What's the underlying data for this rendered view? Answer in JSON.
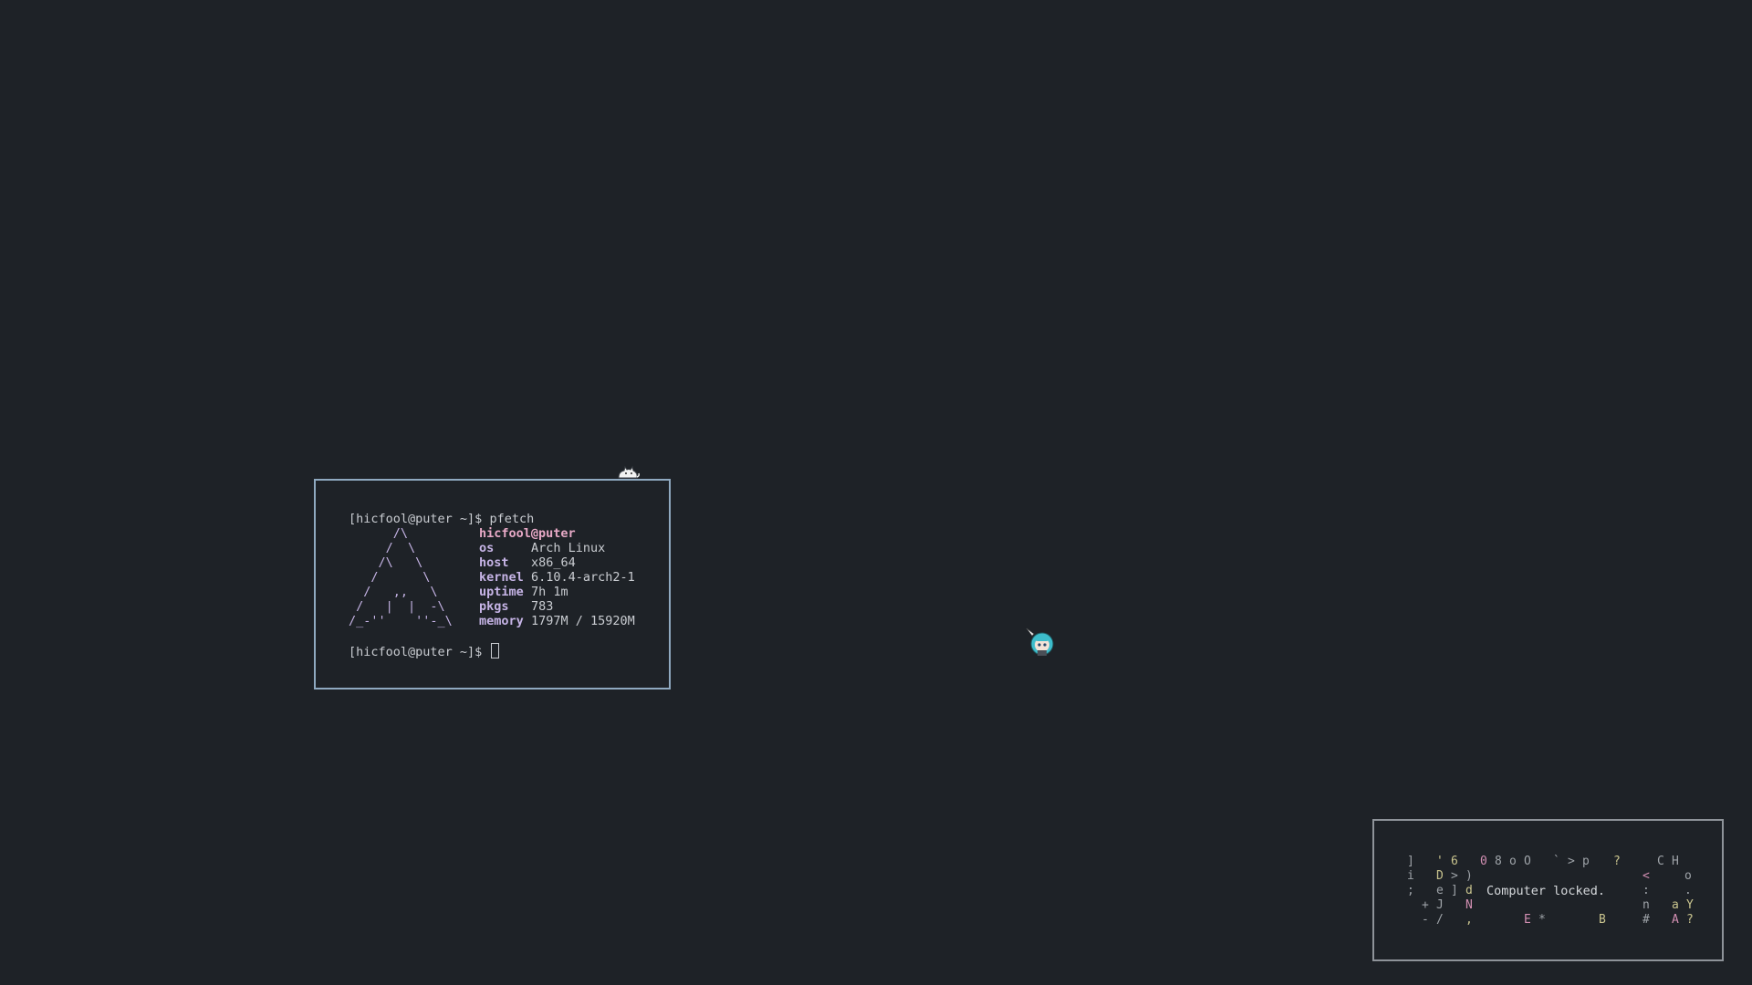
{
  "terminal": {
    "prompt": "[hicfool@puter ~]$",
    "command": "pfetch",
    "userhost": "hicfool@puter",
    "logo_lines": [
      "      /\\",
      "     /  \\",
      "    /\\   \\",
      "   /      \\",
      "  /   ,,   \\",
      " /   |  |  -\\",
      "/_-''    ''-_\\"
    ],
    "info": [
      {
        "key": "os",
        "value": "Arch Linux"
      },
      {
        "key": "host",
        "value": "x86_64"
      },
      {
        "key": "kernel",
        "value": "6.10.4-arch2-1"
      },
      {
        "key": "uptime",
        "value": "7h 1m"
      },
      {
        "key": "pkgs",
        "value": "783"
      },
      {
        "key": "memory",
        "value": "1797M / 15920M"
      }
    ],
    "second_prompt": "[hicfool@puter ~]$"
  },
  "lock": {
    "message": "Computer locked.",
    "glyphs": [
      {
        "c": "]",
        "tone": "grey"
      },
      {
        "c": "'",
        "tone": "yellow"
      },
      {
        "c": "6",
        "tone": "yellow"
      },
      {
        "c": "0",
        "tone": "pink"
      },
      {
        "c": "8",
        "tone": "grey"
      },
      {
        "c": "o",
        "tone": "grey"
      },
      {
        "c": "O",
        "tone": "grey"
      },
      {
        "c": "`",
        "tone": "grey"
      },
      {
        "c": ">",
        "tone": "grey"
      },
      {
        "c": "p",
        "tone": "grey"
      },
      {
        "c": "?",
        "tone": "yellow"
      },
      {
        "c": "C",
        "tone": "grey"
      },
      {
        "c": "H",
        "tone": "grey"
      },
      {
        "c": "i",
        "tone": "grey"
      },
      {
        "c": "D",
        "tone": "yellow"
      },
      {
        "c": ">",
        "tone": "grey"
      },
      {
        "c": ")",
        "tone": "grey"
      },
      {
        "c": "<",
        "tone": "pink"
      },
      {
        "c": "o",
        "tone": "grey"
      },
      {
        "c": ";",
        "tone": "grey"
      },
      {
        "c": "e",
        "tone": "grey"
      },
      {
        "c": "]",
        "tone": "grey"
      },
      {
        "c": "d",
        "tone": "yellow"
      },
      {
        "c": ":",
        "tone": "grey"
      },
      {
        "c": ".",
        "tone": "grey"
      },
      {
        "c": "+",
        "tone": "grey"
      },
      {
        "c": "J",
        "tone": "grey"
      },
      {
        "c": "N",
        "tone": "pink"
      },
      {
        "c": "n",
        "tone": "grey"
      },
      {
        "c": "a",
        "tone": "yellow"
      },
      {
        "c": "Y",
        "tone": "yellow"
      },
      {
        "c": "-",
        "tone": "grey"
      },
      {
        "c": "/",
        "tone": "grey"
      },
      {
        "c": ",",
        "tone": "yellow"
      },
      {
        "c": "E",
        "tone": "pink"
      },
      {
        "c": "*",
        "tone": "grey"
      },
      {
        "c": "B",
        "tone": "yellow"
      },
      {
        "c": "#",
        "tone": "grey"
      },
      {
        "c": "A",
        "tone": "pink"
      },
      {
        "c": "?",
        "tone": "yellow"
      }
    ]
  },
  "colors": {
    "background": "#1e2227",
    "terminal_border": "#8fa9c0",
    "lock_border": "#8e9399",
    "logo": "#c6b4e6",
    "userhost": "#e7a9c6",
    "text": "#c9ccd1"
  }
}
